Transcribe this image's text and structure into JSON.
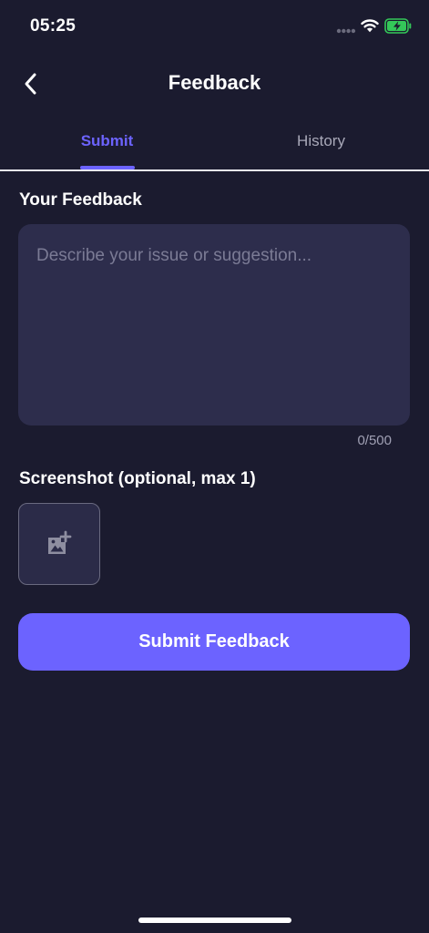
{
  "status_bar": {
    "time": "05:25"
  },
  "header": {
    "title": "Feedback",
    "back_icon": "chevron-left-icon"
  },
  "tabs": [
    {
      "label": "Submit",
      "active": true
    },
    {
      "label": "History",
      "active": false
    }
  ],
  "feedback": {
    "label": "Your Feedback",
    "placeholder": "Describe your issue or suggestion...",
    "value": "",
    "char_count": "0/500"
  },
  "screenshot": {
    "label": "Screenshot (optional, max 1)",
    "add_icon": "add-image-icon"
  },
  "submit": {
    "label": "Submit Feedback"
  },
  "colors": {
    "background": "#1b1b2f",
    "accent": "#6c63ff",
    "input_background": "#2d2d4c",
    "inactive_tab": "#a8a8b8",
    "battery_green": "#34c759"
  }
}
